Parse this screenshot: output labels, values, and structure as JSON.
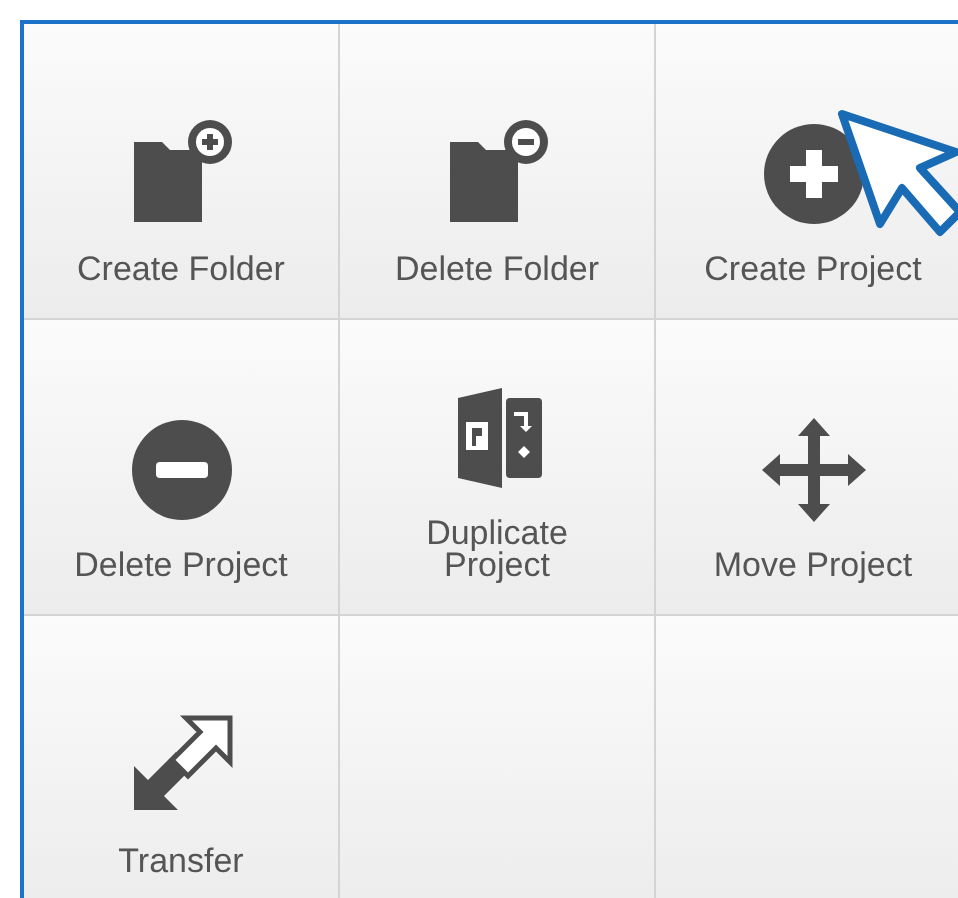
{
  "tiles": [
    {
      "kind": "folder-plus",
      "label": "Create Folder"
    },
    {
      "kind": "folder-minus",
      "label": "Delete Folder"
    },
    {
      "kind": "circle-plus",
      "label": "Create Project"
    },
    {
      "kind": "circle-minus",
      "label": "Delete Project"
    },
    {
      "kind": "duplicate",
      "label": "Duplicate Project"
    },
    {
      "kind": "move",
      "label": "Move Project"
    },
    {
      "kind": "transfer",
      "label": "Transfer"
    },
    {
      "kind": "empty"
    },
    {
      "kind": "empty"
    }
  ]
}
